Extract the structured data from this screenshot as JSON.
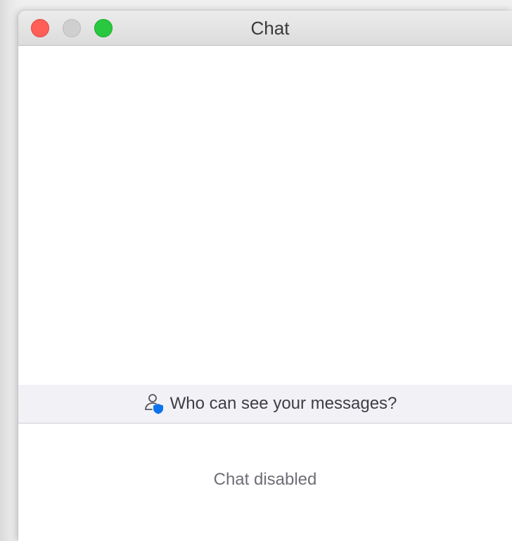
{
  "window": {
    "title": "Chat"
  },
  "privacy": {
    "text": "Who can see your messages?",
    "icon": "user-shield-icon"
  },
  "composer": {
    "status_text": "Chat disabled"
  },
  "colors": {
    "close": "#fe5f57",
    "minimize": "#cfcfcf",
    "zoom": "#28c840",
    "shield": "#0e72ed"
  }
}
